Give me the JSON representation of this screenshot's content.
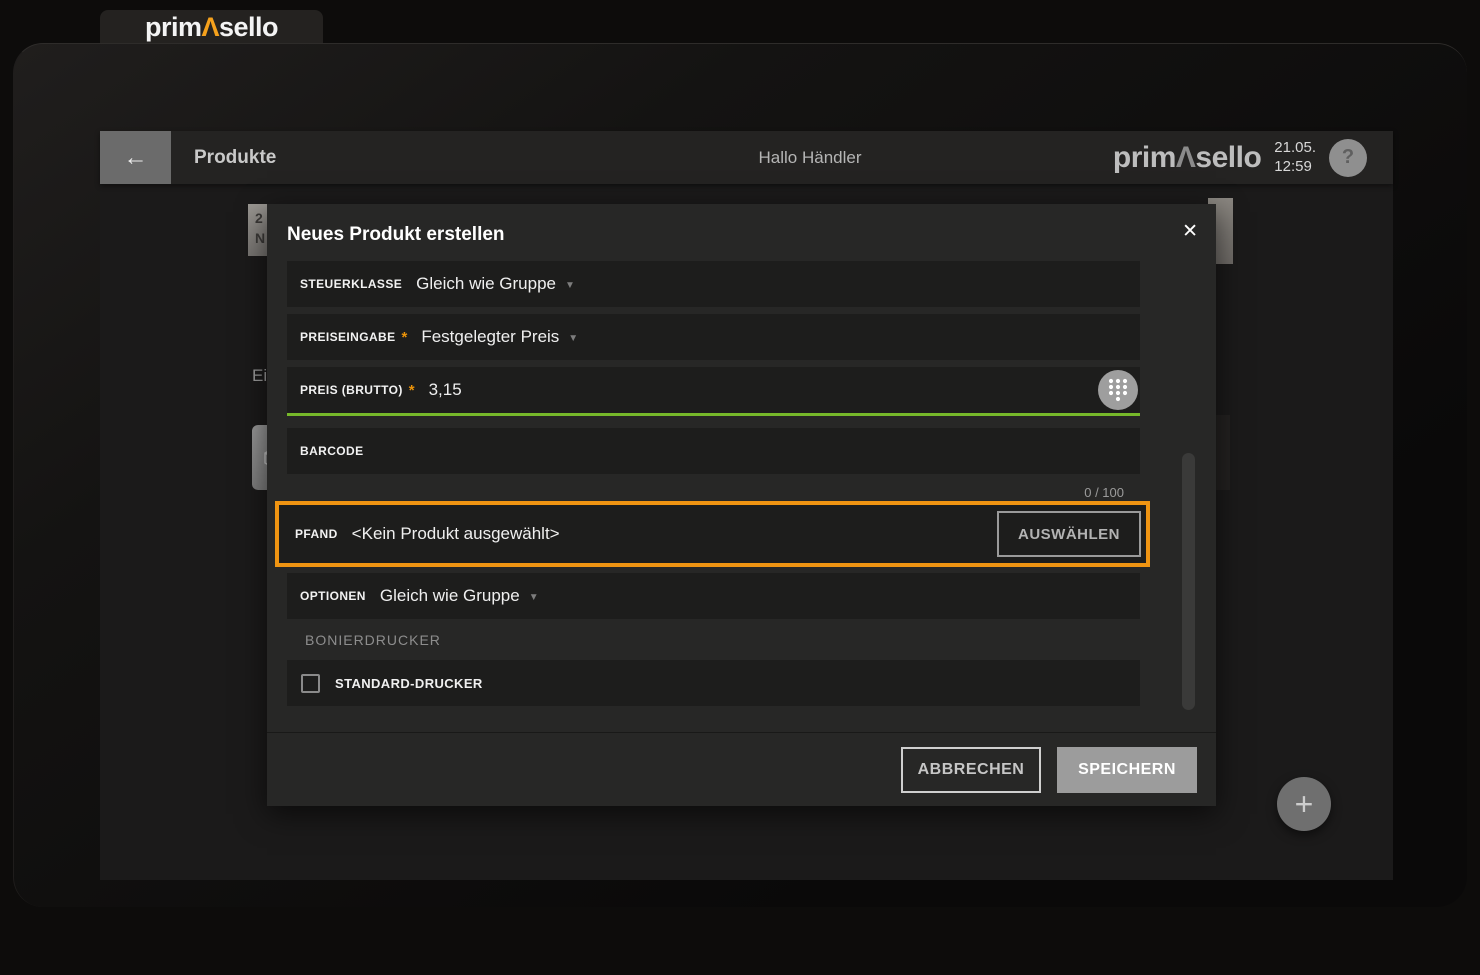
{
  "colors": {
    "accent_orange": "#ef9412",
    "accent_green": "#76b82a"
  },
  "tab": {
    "logo_prefix": "prim",
    "logo_mark": "Λ",
    "logo_suffix": "sello"
  },
  "appbar": {
    "back_icon": "←",
    "title": "Produkte",
    "greeting": "Hallo Händler",
    "logo_prefix": "prim",
    "logo_mark": "Λ",
    "logo_suffix": "sello",
    "date": "21.05.",
    "time": "12:59",
    "help_icon": "?"
  },
  "background_page": {
    "badge_line1": "2",
    "badge_line2": "N",
    "clipped_heading": "Ei"
  },
  "modal": {
    "title": "Neues Produkt erstellen",
    "close_icon": "✕",
    "dropdown_icon": "▼",
    "steuerklasse_label": "STEUERKLASSE",
    "steuerklasse_value": "Gleich wie Gruppe",
    "preiseingabe_label": "PREISEINGABE",
    "preiseingabe_required": "*",
    "preiseingabe_value": "Festgelegter Preis",
    "preis_label": "PREIS (BRUTTO)",
    "preis_required": "*",
    "preis_value": "3,15",
    "barcode_label": "BARCODE",
    "barcode_counter": "0 / 100",
    "pfand_label": "PFAND",
    "pfand_value": "<Kein Produkt ausgewählt>",
    "pfand_button": "AUSWÄHLEN",
    "optionen_label": "OPTIONEN",
    "optionen_value": "Gleich wie Gruppe",
    "bonierdrucker_section": "BONIERDRUCKER",
    "drucker_checkbox_label": "STANDARD-DRUCKER",
    "cancel_button": "ABBRECHEN",
    "save_button": "SPEICHERN"
  },
  "fab": {
    "plus_icon": "+"
  }
}
